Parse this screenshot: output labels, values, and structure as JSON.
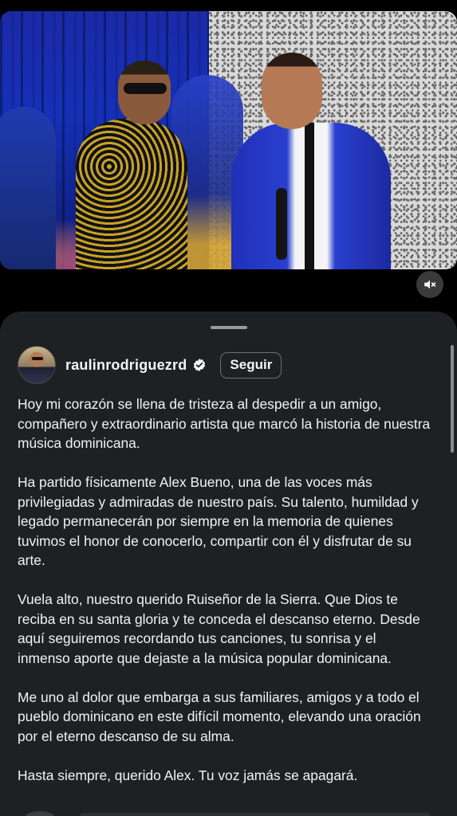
{
  "post": {
    "username": "raulinrodriguezrd",
    "verified": true,
    "follow_label": "Seguir"
  },
  "media": {
    "sound_icon": "speaker-muted-icon"
  },
  "caption": {
    "paragraphs": [
      "Hoy mi corazón se llena de tristeza al despedir a un amigo, compañero y extraordinario artista que marcó la historia de nuestra música dominicana.",
      "Ha partido físicamente Alex Bueno, una de las voces más privilegiadas y admiradas de nuestro país. Su talento, humildad y legado permanecerán por siempre en la memoria de quienes tuvimos el honor de conocerlo, compartir con él y disfrutar de su arte.",
      "Vuela alto, nuestro querido Ruiseñor de la Sierra. Que Dios te reciba en su santa gloria y te conceda el descanso eterno. Desde aquí seguiremos recordando tus canciones, tu sonrisa y el inmenso aporte que dejaste a la música popular dominicana.",
      "Me uno al dolor que embarga a sus familiares, amigos y a todo el pueblo dominicano en este difícil momento, elevando una oración por el eterno descanso de su alma.",
      "Hasta siempre, querido Alex. Tu voz jamás se apagará."
    ]
  },
  "colors": {
    "background": "#000000",
    "sheet": "#1e2124",
    "text": "#f2f2f2",
    "verified_badge": "#ffffff"
  }
}
